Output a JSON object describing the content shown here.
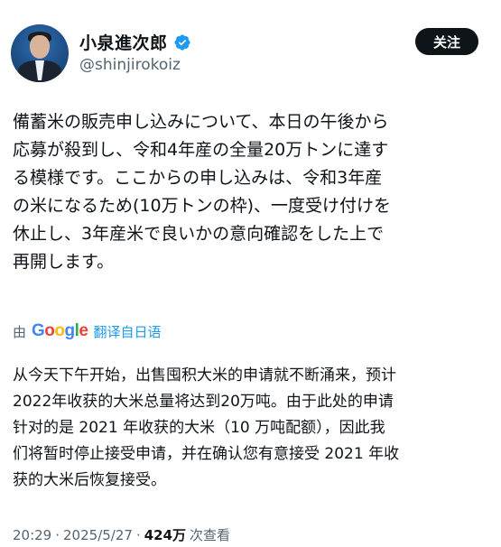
{
  "author": {
    "display_name": "小泉進次郎",
    "handle": "@shinjirokoiz"
  },
  "follow_label": "关注",
  "tweet": {
    "text": "備蓄米の販売申し込みについて、本日の午後から\n応募が殺到し、令和4年産の全量20万トンに達す\nる模様です。ここからの申し込みは、令和3年産\nの米になるため(10万トンの枠)、一度受け付けを\n休止し、3年産米で良いかの意向確認をした上で\n再開します。"
  },
  "translation": {
    "by_label": "由",
    "google_letters": [
      "G",
      "o",
      "o",
      "g",
      "l",
      "e"
    ],
    "link_label": "翻译自日语",
    "text": "从今天下午开始，出售囤积大米的申请就不断涌来，预计\n2022年收获的大米总量将达到20万吨。由于此处的申请\n针对的是 2021 年收获的大米（10 万吨配额），因此我\n们将暂时停止接受申请，并在确认您有意接受 2021 年收\n获的大米后恢复接受。"
  },
  "meta": {
    "time": "20:29",
    "separator": "·",
    "date": "2025/5/27",
    "views_count": "424万",
    "views_label": "次查看"
  },
  "colors": {
    "verified": "#1d9bf0",
    "google_blue": "#4285f4",
    "google_red": "#ea4335",
    "google_yellow": "#fbbc05",
    "google_green": "#34a853"
  }
}
